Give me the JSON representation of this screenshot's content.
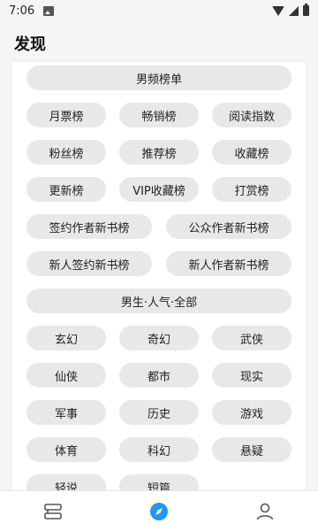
{
  "status_bar": {
    "time": "7:06"
  },
  "app_bar": {
    "title": "发现"
  },
  "section_male_rank": {
    "header": "男频榜单",
    "items": [
      "月票榜",
      "畅销榜",
      "阅读指数",
      "粉丝榜",
      "推荐榜",
      "收藏榜",
      "更新榜",
      "VIP收藏榜",
      "打赏榜"
    ],
    "wide_items": [
      "签约作者新书榜",
      "公众作者新书榜",
      "新人签约新书榜",
      "新人作者新书榜"
    ]
  },
  "section_male_popular": {
    "header": "男生·人气·全部",
    "items": [
      "玄幻",
      "奇幻",
      "武侠",
      "仙侠",
      "都市",
      "现实",
      "军事",
      "历史",
      "游戏",
      "体育",
      "科幻",
      "悬疑",
      "轻说",
      "短篇"
    ]
  },
  "bottom_nav": {
    "items": [
      "bookshelf",
      "discover",
      "profile"
    ],
    "active": "discover",
    "accent_color": "#2196f3"
  }
}
